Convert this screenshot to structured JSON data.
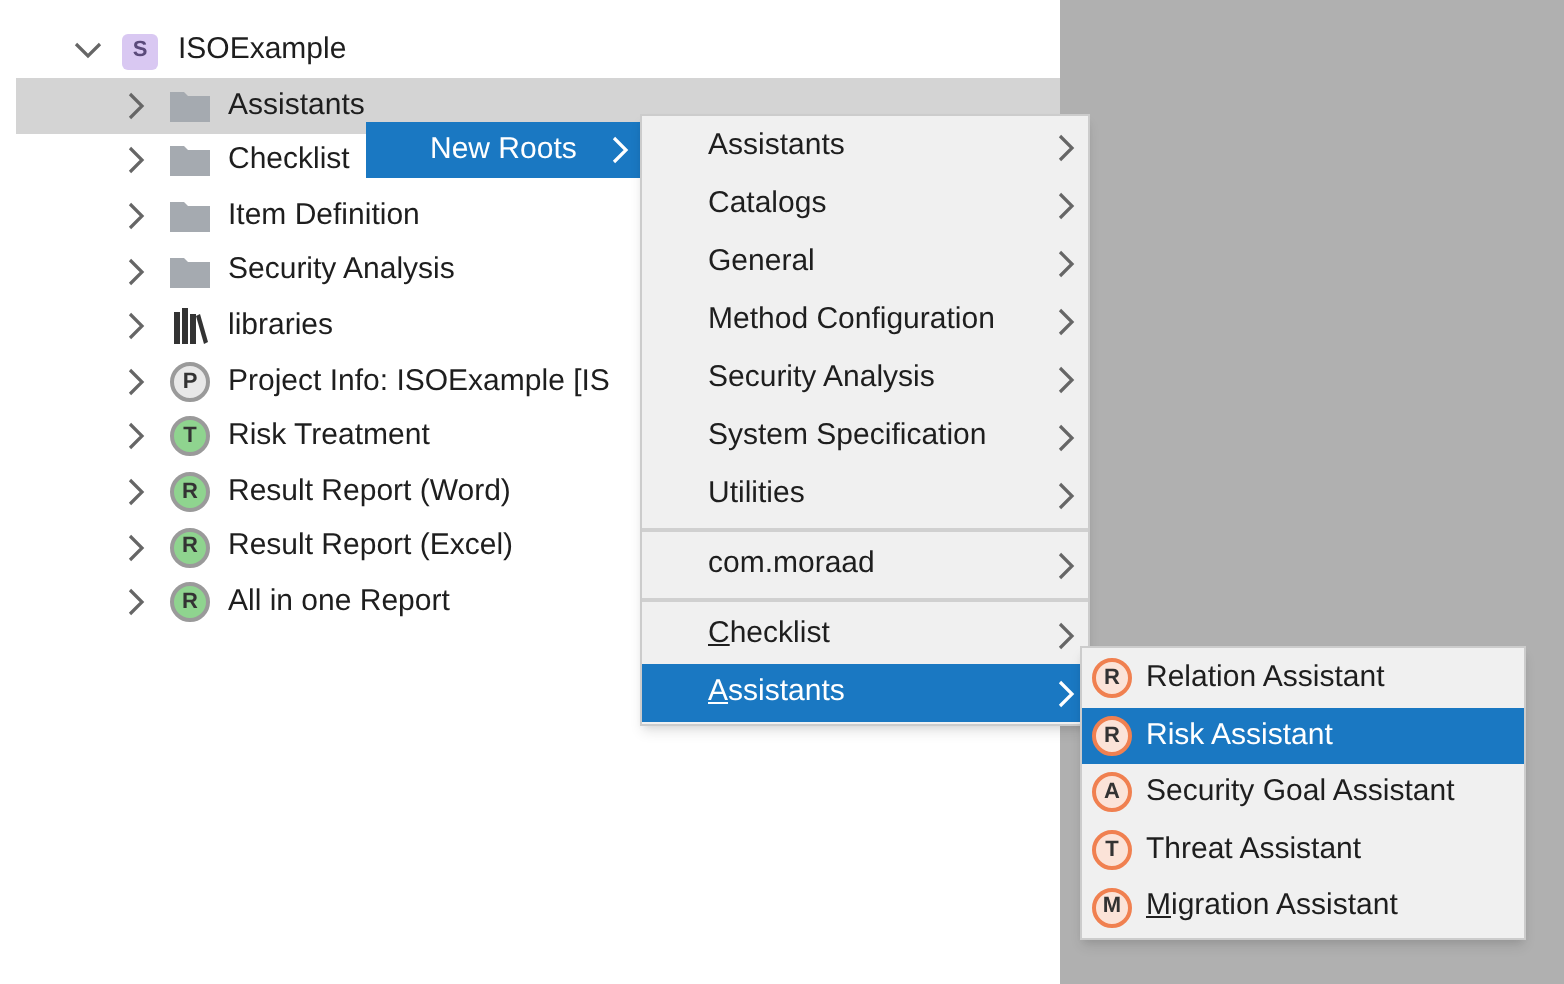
{
  "tree": {
    "root": {
      "label": "ISOExample",
      "badge": "S",
      "expanded": true,
      "children": [
        {
          "label": "Assistants",
          "kind": "folder",
          "selected": true,
          "expanded": false
        },
        {
          "label": "Checklist",
          "kind": "folder",
          "selected": false,
          "expanded": false
        },
        {
          "label": "Item Definition",
          "kind": "folder",
          "selected": false,
          "expanded": false
        },
        {
          "label": "Security Analysis",
          "kind": "folder",
          "selected": false,
          "expanded": false
        },
        {
          "label": "libraries",
          "kind": "library",
          "selected": false,
          "expanded": false
        },
        {
          "label": "Project Info: ISOExample [IS",
          "kind": "badge",
          "badge": "P",
          "color": "#e8e8e8",
          "selected": false,
          "expanded": false
        },
        {
          "label": "Risk Treatment",
          "kind": "badge",
          "badge": "T",
          "color": "#8fd48f",
          "selected": false,
          "expanded": false
        },
        {
          "label": "Result Report (Word)",
          "kind": "badge",
          "badge": "R",
          "color": "#8fd48f",
          "selected": false,
          "expanded": false
        },
        {
          "label": "Result Report (Excel)",
          "kind": "badge",
          "badge": "R",
          "color": "#8fd48f",
          "selected": false,
          "expanded": false
        },
        {
          "label": "All in one Report",
          "kind": "badge",
          "badge": "R",
          "color": "#8fd48f",
          "selected": false,
          "expanded": false
        }
      ]
    }
  },
  "context_menu": {
    "items": [
      {
        "label": "New Roots",
        "selected": true,
        "submenu": true
      }
    ]
  },
  "new_roots_menu": {
    "sections": [
      [
        {
          "label": "Assistants",
          "selected": false,
          "underline_first": false
        },
        {
          "label": "Catalogs",
          "selected": false,
          "underline_first": false
        },
        {
          "label": "General",
          "selected": false,
          "underline_first": false
        },
        {
          "label": "Method Configuration",
          "selected": false,
          "underline_first": false
        },
        {
          "label": "Security Analysis",
          "selected": false,
          "underline_first": false
        },
        {
          "label": "System Specification",
          "selected": false,
          "underline_first": false
        },
        {
          "label": "Utilities",
          "selected": false,
          "underline_first": false
        }
      ],
      [
        {
          "label": "com.moraad",
          "selected": false,
          "underline_first": false
        }
      ],
      [
        {
          "label": "Checklist",
          "selected": false,
          "underline_first": true
        },
        {
          "label": "Assistants",
          "selected": true,
          "underline_first": true
        }
      ]
    ]
  },
  "assistants_menu": {
    "items": [
      {
        "badge": "R",
        "label": "Relation Assistant",
        "selected": false,
        "underline_first": false
      },
      {
        "badge": "R",
        "label": "Risk Assistant",
        "selected": true,
        "underline_first": false
      },
      {
        "badge": "A",
        "label": "Security Goal Assistant",
        "selected": false,
        "underline_first": false
      },
      {
        "badge": "T",
        "label": "Threat Assistant",
        "selected": false,
        "underline_first": false
      },
      {
        "badge": "M",
        "label": "Migration Assistant",
        "selected": false,
        "underline_first": true
      }
    ]
  }
}
